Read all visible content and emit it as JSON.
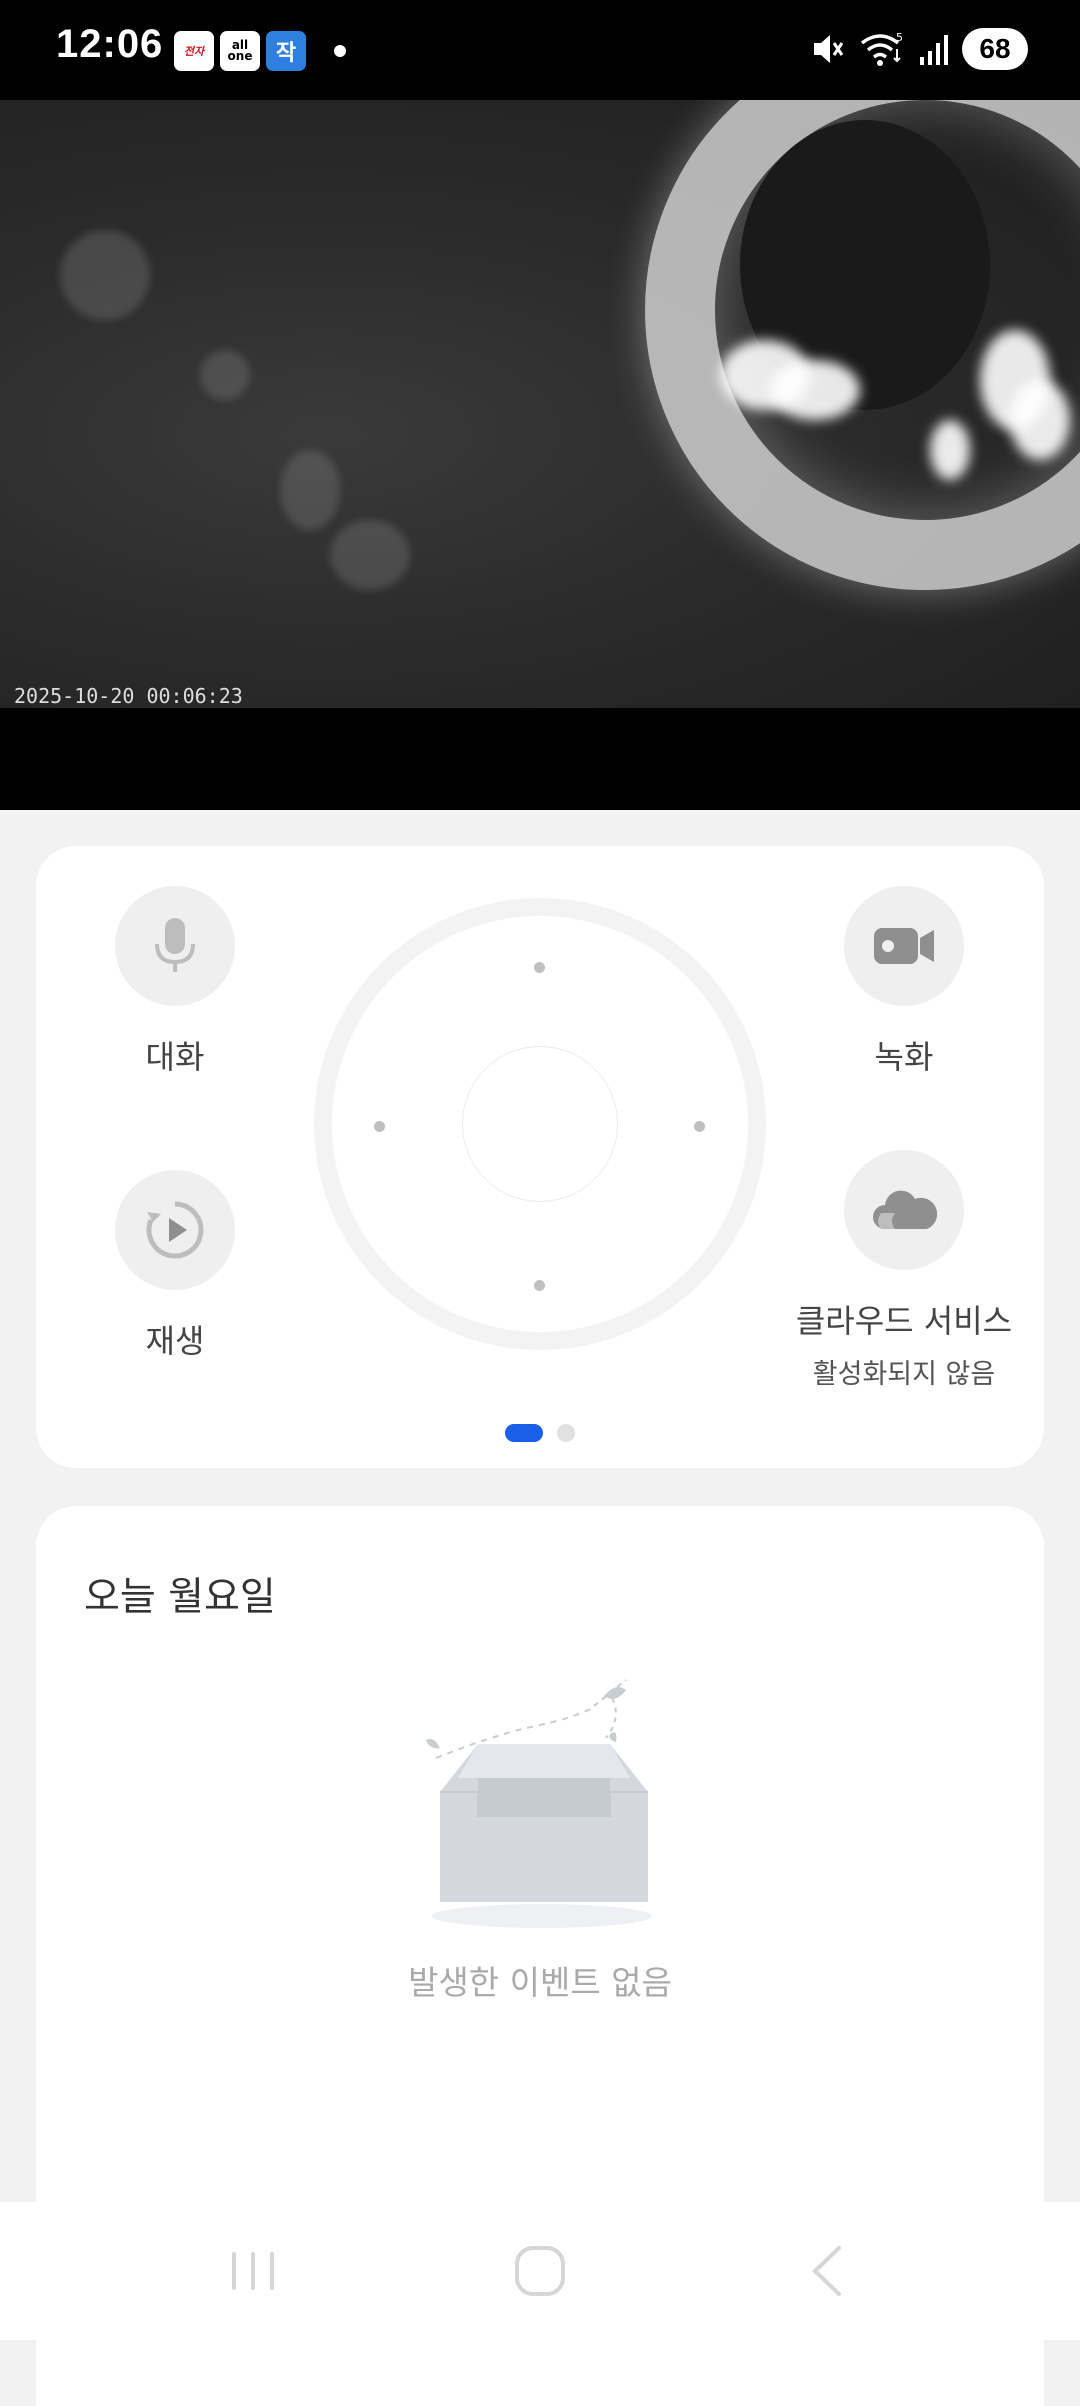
{
  "status_bar": {
    "time": "12:06",
    "battery": "68",
    "notification_icons": [
      "news-app-icon",
      "allone-app-icon",
      "korean-app-icon"
    ],
    "system_icons": [
      "mute-icon",
      "wifi-icon",
      "signal-icon",
      "battery-icon"
    ]
  },
  "camera": {
    "timestamp": "2025-10-20  00:06:23"
  },
  "controls": {
    "talk_label": "대화",
    "record_label": "녹화",
    "playback_label": "재생",
    "cloud_label": "클라우드 서비스",
    "cloud_status": "활성화되지 않음",
    "page_indicator": {
      "current": 1,
      "total": 2
    },
    "accent_color": "#1a5fe8"
  },
  "events": {
    "title": "오늘 월요일",
    "empty_text": "발생한 이벤트 없음"
  },
  "nav_bar": {
    "buttons": [
      "recent-apps-icon",
      "home-icon",
      "back-icon"
    ]
  }
}
